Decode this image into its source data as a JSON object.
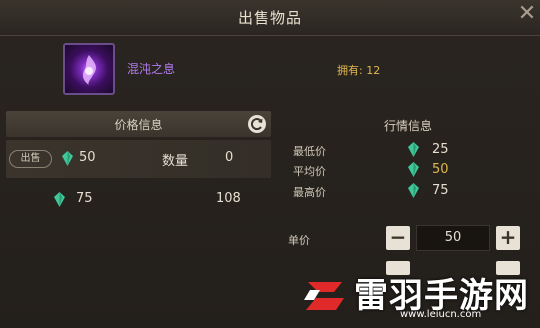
{
  "title": "出售物品",
  "close_symbol": "✕",
  "item": {
    "name": "混沌之息",
    "owned_label": "拥有: 12"
  },
  "price_panel": {
    "header": "价格信息",
    "sell_tag": "出售",
    "quantity_label": "数量",
    "rows": [
      {
        "price": "50",
        "quantity": "0"
      },
      {
        "price": "75",
        "quantity": "108"
      }
    ]
  },
  "market_panel": {
    "header": "行情信息",
    "min_label": "最低价",
    "min_value": "25",
    "avg_label": "平均价",
    "avg_value": "50",
    "max_label": "最高价",
    "max_value": "75"
  },
  "unit_price": {
    "label": "单价",
    "value": "50",
    "minus": "−",
    "plus": "+"
  },
  "watermark": {
    "text": "雷羽手游网",
    "url": "www.leiucn.com"
  },
  "colors": {
    "gem": "#3fc79a",
    "accent_gold": "#e0b74f",
    "item_purple": "#b37cf0"
  },
  "icons": {
    "gem": "green-gem-icon",
    "refresh": "refresh-icon",
    "item": "chaos-breath-item-icon"
  }
}
